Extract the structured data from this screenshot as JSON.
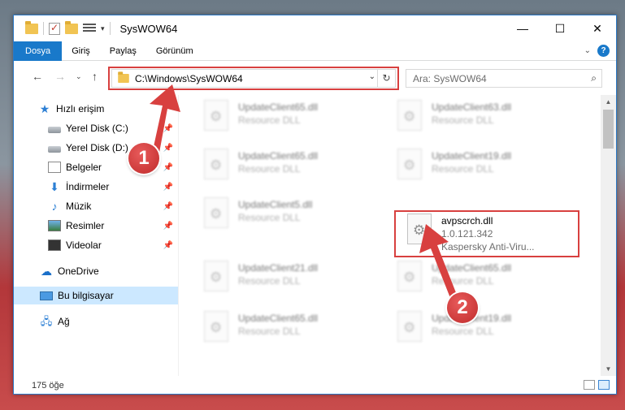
{
  "window": {
    "title": "SysWOW64",
    "minimize": "—",
    "maximize": "☐",
    "close": "✕"
  },
  "ribbon": {
    "tabs": [
      "Dosya",
      "Giriş",
      "Paylaş",
      "Görünüm"
    ],
    "help": "?"
  },
  "address": {
    "path": "C:\\Windows\\SysWOW64",
    "search_placeholder": "Ara: SysWOW64"
  },
  "nav": {
    "quick_access": "Hızlı erişim",
    "items": [
      {
        "label": "Yerel Disk (C:)",
        "icon": "disk-icon"
      },
      {
        "label": "Yerel Disk (D:)",
        "icon": "disk-icon"
      },
      {
        "label": "Belgeler",
        "icon": "document-icon"
      },
      {
        "label": "İndirmeler",
        "icon": "download-icon"
      },
      {
        "label": "Müzik",
        "icon": "music-icon"
      },
      {
        "label": "Resimler",
        "icon": "pictures-icon"
      },
      {
        "label": "Videolar",
        "icon": "video-icon"
      }
    ],
    "onedrive": "OneDrive",
    "this_pc": "Bu bilgisayar",
    "network": "Ağ"
  },
  "files": [
    {
      "name": "UpdateClient65.dll",
      "desc": "Resource DLL"
    },
    {
      "name": "UpdateClient63.dll",
      "desc": "Resource DLL"
    },
    {
      "name": "UpdateClient65.dll",
      "desc": "Resource DLL"
    },
    {
      "name": "UpdateClient19.dll",
      "desc": "Resource DLL"
    },
    {
      "name": "UpdateClient5.dll",
      "desc": "Resource DLL"
    },
    {
      "name": "avpscrch.dll",
      "version": "1.0.121.342",
      "desc": "Kaspersky Anti-Viru..."
    },
    {
      "name": "UpdateClient21.dll",
      "desc": "Resource DLL"
    },
    {
      "name": "UpdateClient65.dll",
      "desc": "Resource DLL"
    },
    {
      "name": "UpdateClient65.dll",
      "desc": "Resource DLL"
    },
    {
      "name": "UpdateClient19.dll",
      "desc": "Resource DLL"
    }
  ],
  "status": {
    "count": "175 öğe"
  },
  "annotations": {
    "step1": "1",
    "step2": "2",
    "color": "#d8403f"
  }
}
